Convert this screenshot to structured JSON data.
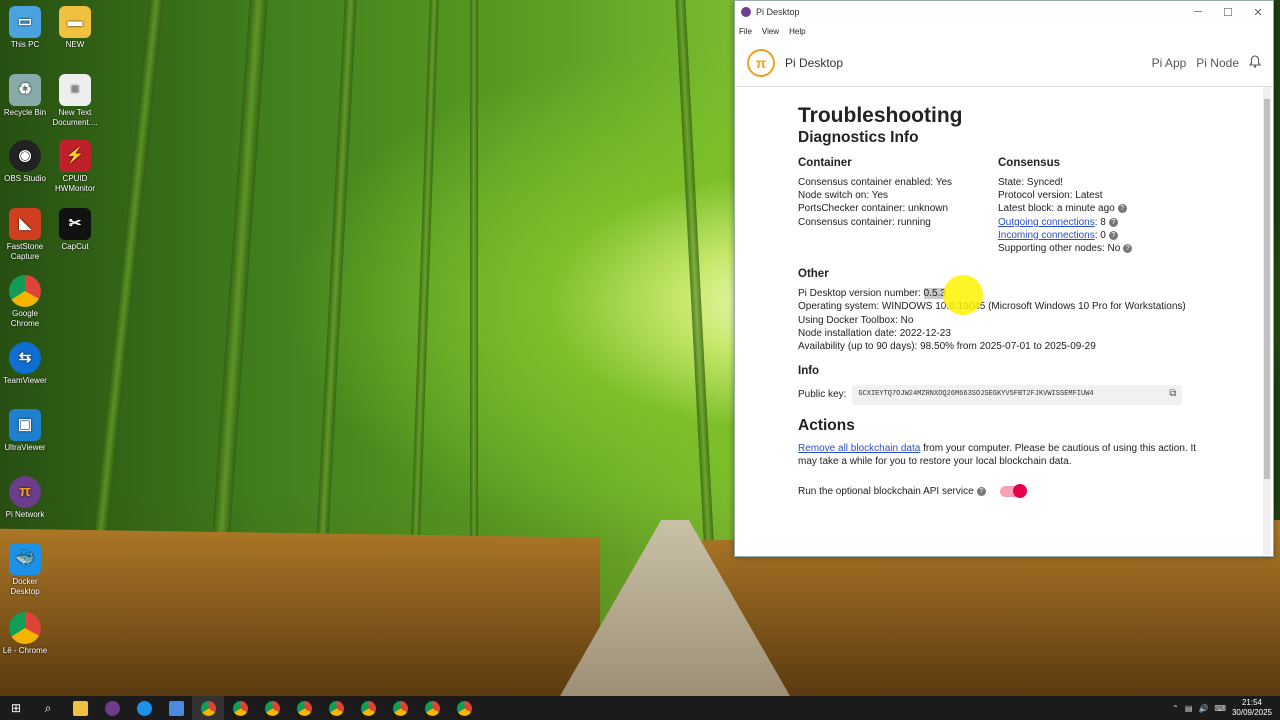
{
  "desktop": {
    "icons": [
      {
        "label": "This PC",
        "icon": "computer-icon",
        "color": "#4aa3df"
      },
      {
        "label": "NEW",
        "icon": "folder-icon",
        "color": "#f0c040"
      },
      {
        "label": "Recycle Bin",
        "icon": "recycle-bin-icon",
        "color": "#8aa"
      },
      {
        "label": "New Text Document....",
        "icon": "text-file-icon",
        "color": "#eee"
      },
      {
        "label": "OBS Studio",
        "icon": "obs-icon",
        "color": "#222"
      },
      {
        "label": "CPUID HWMonitor",
        "icon": "hwmonitor-icon",
        "color": "#c0202a"
      },
      {
        "label": "FastStone Capture",
        "icon": "faststone-icon",
        "color": "#d04020"
      },
      {
        "label": "CapCut",
        "icon": "capcut-icon",
        "color": "#111"
      },
      {
        "label": "Google Chrome",
        "icon": "chrome-icon",
        "color": "#e8a020"
      },
      {
        "label": "TeamViewer",
        "icon": "teamviewer-icon",
        "color": "#0e6fd0"
      },
      {
        "label": "UltraViewer",
        "icon": "ultraviewer-icon",
        "color": "#2080d0"
      },
      {
        "label": "Pi Network",
        "icon": "pi-network-icon",
        "color": "#6b3d8a"
      },
      {
        "label": "Docker Desktop",
        "icon": "docker-icon",
        "color": "#1d91e6"
      },
      {
        "label": "Lê - Chrome",
        "icon": "chrome-icon",
        "color": "#e8a020"
      }
    ]
  },
  "window": {
    "title": "Pi Desktop",
    "controls": {
      "minimize": "─",
      "maximize": "☐",
      "close": "✕"
    },
    "menu": [
      "File",
      "View",
      "Help"
    ],
    "brand": "Pi Desktop",
    "logo_glyph": "π",
    "nav": [
      "Pi App",
      "Pi Node"
    ]
  },
  "page": {
    "title": "Troubleshooting",
    "diagnostics_heading": "Diagnostics Info",
    "container": {
      "heading": "Container",
      "lines": [
        "Consensus container enabled: Yes",
        "Node switch on: Yes",
        "PortsChecker container: unknown",
        "Consensus container: running"
      ]
    },
    "consensus": {
      "heading": "Consensus",
      "state": "State: Synced!",
      "protocol": "Protocol version: Latest",
      "latest_block": "Latest block: a minute ago",
      "outgoing_link": "Outgoing connections",
      "outgoing_value": ": 8",
      "incoming_link": "Incoming connections",
      "incoming_value": ": 0",
      "supporting": "Supporting other nodes: No"
    },
    "other": {
      "heading": "Other",
      "version_label": "Pi Desktop version number: ",
      "version_value": "0.5.3",
      "os": "Operating system: WINDOWS 10.0.19045 (Microsoft Windows 10 Pro for Workstations)",
      "docker": "Using Docker Toolbox: No",
      "install_date": "Node installation date: 2022-12-23",
      "availability": "Availability (up to 90 days): 98.50% from 2025-07-01 to 2025-09-29"
    },
    "info": {
      "heading": "Info",
      "pk_label": "Public key:",
      "pk_value": "GCXIEYTQ7OJW24MZRNXOQ26M663SOJSEGKYV5FBT2FJKVWISSEMFIUW4"
    },
    "actions": {
      "heading": "Actions",
      "remove_link": "Remove all blockchain data",
      "remove_text": " from your computer. Please be cautious of using this action. It may take a while for you to restore your local blockchain data.",
      "api_label": "Run the optional blockchain API service",
      "api_enabled": true
    }
  },
  "taskbar": {
    "time": "21:54",
    "date": "30/09/2025"
  }
}
